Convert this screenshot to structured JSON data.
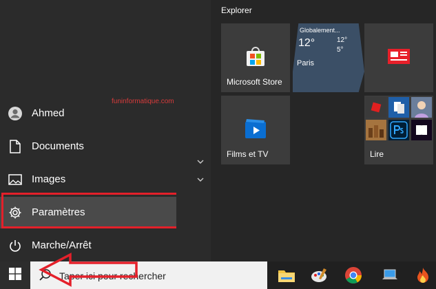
{
  "left_rail": {
    "items": [
      {
        "label": "Ahmed",
        "icon": "user-icon"
      },
      {
        "label": "Documents",
        "icon": "document-icon"
      },
      {
        "label": "Images",
        "icon": "image-icon"
      },
      {
        "label": "Paramètres",
        "icon": "gear-icon"
      },
      {
        "label": "Marche/Arrêt",
        "icon": "power-icon"
      }
    ]
  },
  "watermark": "funinformatique.com",
  "tiles": {
    "group_title": "Explorer",
    "store": {
      "label": "Microsoft Store"
    },
    "weather": {
      "title": "Globalement...",
      "temp": "12°",
      "high": "12°",
      "low": "5°",
      "city": "Paris"
    },
    "films": {
      "label": "Films et TV"
    },
    "read": {
      "label": "Lire"
    }
  },
  "taskbar": {
    "search_placeholder": "Taper ici pour rechercher"
  },
  "colors": {
    "highlight": "#e4202a",
    "accent_blue": "#0078d7"
  }
}
